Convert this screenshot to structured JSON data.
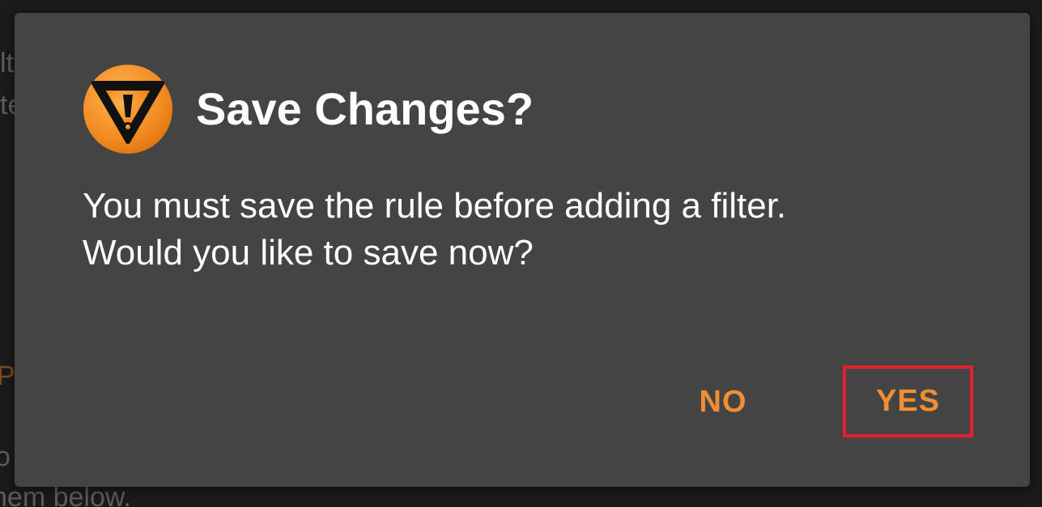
{
  "background": {
    "fragments": [
      "lt",
      "te",
      "P",
      "o",
      "hem below."
    ],
    "colors": {
      "base": "#1b1b1b",
      "muted_text": "#5f5f5f",
      "accent_text": "#7a4d22"
    }
  },
  "dialog": {
    "icon": "alert-warning-triangle-icon",
    "title": "Save Changes?",
    "message_line1": "You must save the rule before adding a filter.",
    "message_line2": "Would you like to save now?",
    "buttons": {
      "no_label": "NO",
      "yes_label": "YES"
    },
    "colors": {
      "surface": "#444444",
      "text": "#ffffff",
      "button_text": "#ef8e34",
      "icon_orange": "#f28b22",
      "highlight_border": "#e5202a"
    }
  }
}
